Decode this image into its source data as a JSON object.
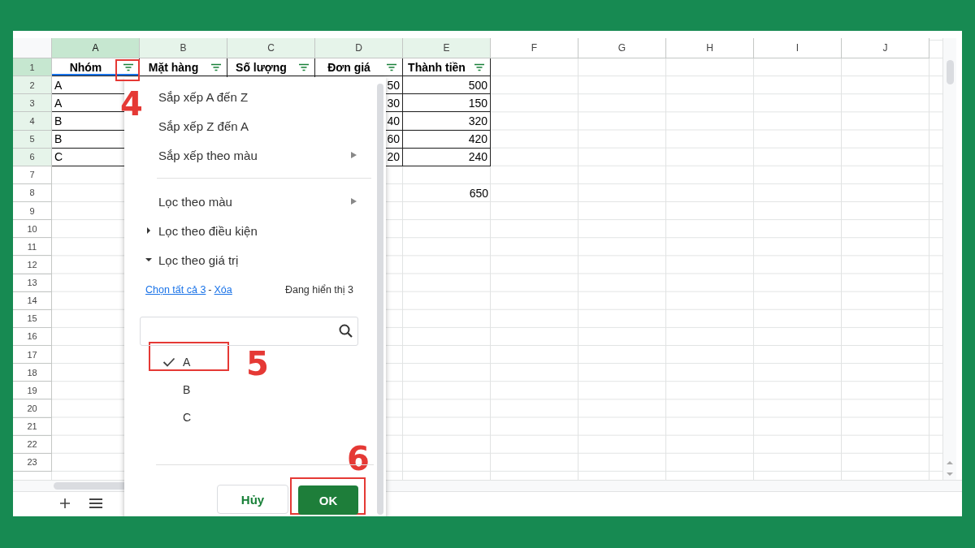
{
  "columns": [
    {
      "label": "A",
      "selected": true,
      "highlighted": true
    },
    {
      "label": "B",
      "selected": false,
      "highlighted": true
    },
    {
      "label": "C",
      "selected": false,
      "highlighted": true
    },
    {
      "label": "D",
      "selected": false,
      "highlighted": true
    },
    {
      "label": "E",
      "selected": false,
      "highlighted": true
    },
    {
      "label": "F",
      "selected": false,
      "highlighted": false
    },
    {
      "label": "G",
      "selected": false,
      "highlighted": false
    },
    {
      "label": "H",
      "selected": false,
      "highlighted": false
    },
    {
      "label": "I",
      "selected": false,
      "highlighted": false
    },
    {
      "label": "J",
      "selected": false,
      "highlighted": false
    }
  ],
  "rows": [
    {
      "number": "1",
      "kind": "header",
      "selected": true,
      "highlighted": true,
      "cells": {
        "A": "Nhóm",
        "B": "Mặt hàng",
        "C": "Số lượng",
        "D": "Đơn giá",
        "E": "Thành tiền"
      }
    },
    {
      "number": "2",
      "kind": "data",
      "selected": false,
      "highlighted": true,
      "cells": {
        "A": "A",
        "D": "50",
        "E": "500"
      }
    },
    {
      "number": "3",
      "kind": "data",
      "selected": false,
      "highlighted": true,
      "cells": {
        "A": "A",
        "D": "30",
        "E": "150"
      }
    },
    {
      "number": "4",
      "kind": "data",
      "selected": false,
      "highlighted": true,
      "cells": {
        "A": "B",
        "D": "40",
        "E": "320"
      }
    },
    {
      "number": "5",
      "kind": "data",
      "selected": false,
      "highlighted": true,
      "cells": {
        "A": "B",
        "D": "60",
        "E": "420"
      }
    },
    {
      "number": "6",
      "kind": "data",
      "selected": false,
      "highlighted": true,
      "cells": {
        "A": "C",
        "D": "20",
        "E": "240"
      }
    },
    {
      "number": "7",
      "kind": "plain",
      "selected": false,
      "highlighted": false,
      "cells": {}
    },
    {
      "number": "8",
      "kind": "plain",
      "selected": false,
      "highlighted": false,
      "cells": {
        "E": "650"
      }
    },
    {
      "number": "9",
      "kind": "plain",
      "selected": false,
      "highlighted": false,
      "cells": {}
    },
    {
      "number": "10",
      "kind": "plain",
      "selected": false,
      "highlighted": false,
      "cells": {}
    },
    {
      "number": "11",
      "kind": "plain",
      "selected": false,
      "highlighted": false,
      "cells": {}
    },
    {
      "number": "12",
      "kind": "plain",
      "selected": false,
      "highlighted": false,
      "cells": {}
    },
    {
      "number": "13",
      "kind": "plain",
      "selected": false,
      "highlighted": false,
      "cells": {}
    },
    {
      "number": "14",
      "kind": "plain",
      "selected": false,
      "highlighted": false,
      "cells": {}
    },
    {
      "number": "15",
      "kind": "plain",
      "selected": false,
      "highlighted": false,
      "cells": {}
    },
    {
      "number": "16",
      "kind": "plain",
      "selected": false,
      "highlighted": false,
      "cells": {}
    },
    {
      "number": "17",
      "kind": "plain",
      "selected": false,
      "highlighted": false,
      "cells": {}
    },
    {
      "number": "18",
      "kind": "plain",
      "selected": false,
      "highlighted": false,
      "cells": {}
    },
    {
      "number": "19",
      "kind": "plain",
      "selected": false,
      "highlighted": false,
      "cells": {}
    },
    {
      "number": "20",
      "kind": "plain",
      "selected": false,
      "highlighted": false,
      "cells": {}
    },
    {
      "number": "21",
      "kind": "plain",
      "selected": false,
      "highlighted": false,
      "cells": {}
    },
    {
      "number": "22",
      "kind": "plain",
      "selected": false,
      "highlighted": false,
      "cells": {}
    },
    {
      "number": "23",
      "kind": "plain",
      "selected": false,
      "highlighted": false,
      "cells": {}
    }
  ],
  "filter_menu": {
    "items": [
      {
        "kind": "action",
        "label": "Sắp xếp A đến Z"
      },
      {
        "kind": "action",
        "label": "Sắp xếp Z đến A"
      },
      {
        "kind": "submenu",
        "label": "Sắp xếp theo màu"
      },
      {
        "kind": "divider"
      },
      {
        "kind": "submenu",
        "label": "Lọc theo màu"
      },
      {
        "kind": "section",
        "label": "Lọc theo điều kiện",
        "expanded": false
      },
      {
        "kind": "section",
        "label": "Lọc theo giá trị",
        "expanded": true
      }
    ],
    "select_all": "Chọn tất cả 3",
    "separator": "-",
    "clear": "Xóa",
    "showing": "Đang hiển thị 3",
    "values": [
      {
        "label": "A",
        "checked": true
      },
      {
        "label": "B",
        "checked": false
      },
      {
        "label": "C",
        "checked": false
      }
    ],
    "cancel": "Hủy",
    "ok": "OK"
  },
  "annotations": [
    {
      "label": "4"
    },
    {
      "label": "5"
    },
    {
      "label": "6"
    }
  ]
}
